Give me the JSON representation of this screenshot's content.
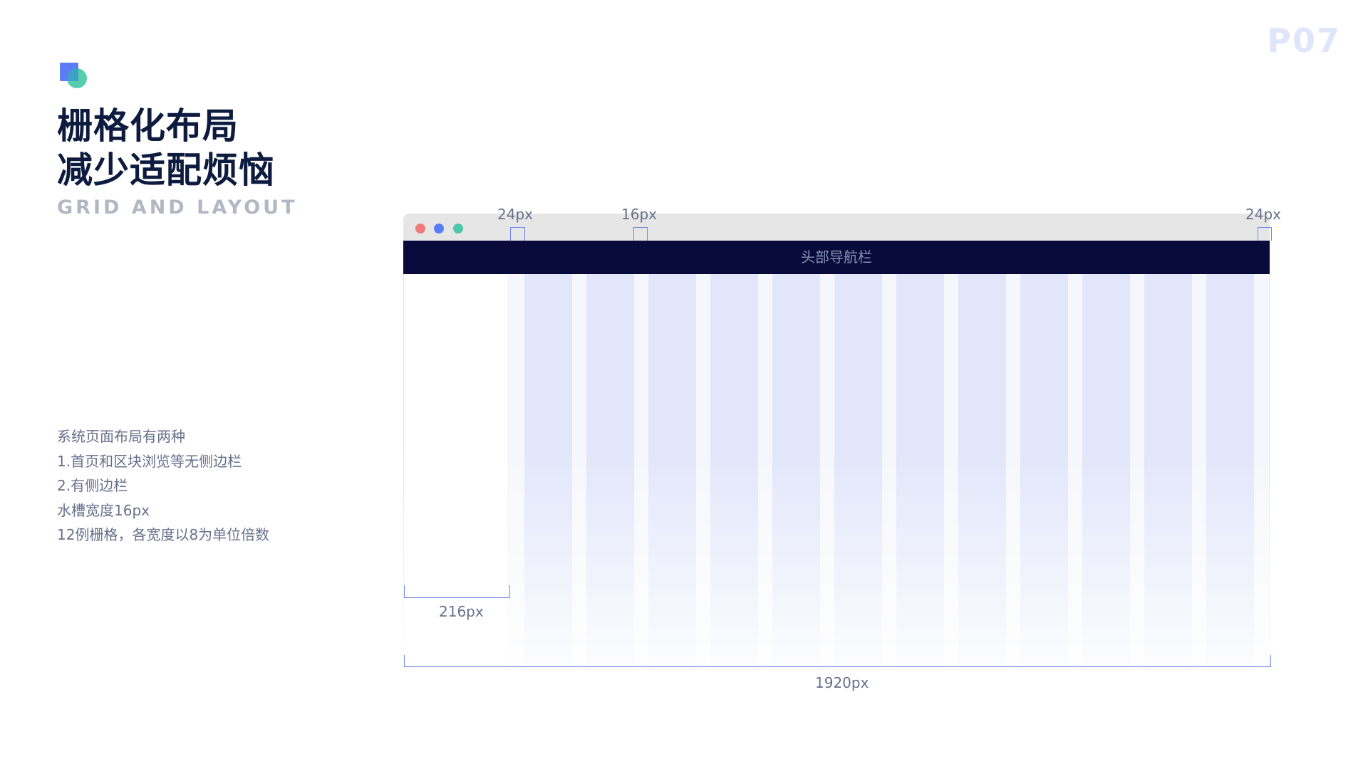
{
  "header": {
    "title_line1": "栅格化布局",
    "title_line2": "减少适配烦恼",
    "subtitle": "GRID AND LAYOUT",
    "page_number": "P07"
  },
  "description": [
    "系统页面布局有两种",
    "1.首页和区块浏览等无侧边栏",
    "2.有侧边栏",
    "水槽宽度16px",
    "12例栅格，各宽度以8为单位倍数"
  ],
  "diagram": {
    "navbar_label": "头部导航栏",
    "margin_left_label": "24px",
    "gutter_label": "16px",
    "margin_right_label": "24px",
    "sidebar_width_label": "216px",
    "total_width_label": "1920px",
    "column_count": 12
  },
  "colors": {
    "accent": "#5b7cf4",
    "teal": "#44c9a5",
    "navbar": "#070a3b",
    "column": "#e1e6fa",
    "title": "#0d1b3e"
  }
}
